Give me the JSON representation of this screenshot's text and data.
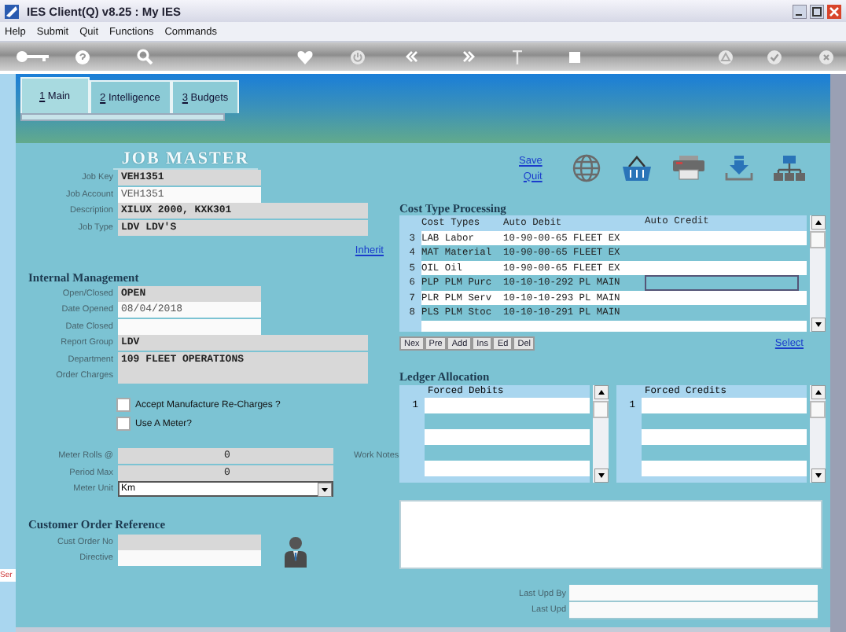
{
  "window": {
    "title": "IES Client(Q) v8.25 : My IES"
  },
  "menu": [
    "Help",
    "Submit",
    "Quit",
    "Functions",
    "Commands"
  ],
  "tabs": [
    {
      "hotkey": "1",
      "label": "Main",
      "selected": true
    },
    {
      "hotkey": "2",
      "label": "Intelligence",
      "selected": false
    },
    {
      "hotkey": "3",
      "label": "Budgets",
      "selected": false
    }
  ],
  "page_title": "JOB MASTER",
  "links": [
    "Save",
    "Quit"
  ],
  "job_fields": [
    {
      "label": "Job Key",
      "value": "VEH1351",
      "kind": "short",
      "editable": false
    },
    {
      "label": "Job Account",
      "value": "VEH1351",
      "kind": "short",
      "editable": true
    },
    {
      "label": "Description",
      "value": "XILUX 2000, KXK301",
      "kind": "wide",
      "editable": false
    },
    {
      "label": "Job Type",
      "value": "LDV LDV'S",
      "kind": "wide",
      "editable": false
    }
  ],
  "inherit_link": "Inherit",
  "internal_management": {
    "heading": "Internal Management",
    "fields": [
      {
        "label": "Open/Closed",
        "value": "OPEN",
        "kind": "short",
        "editable": false
      },
      {
        "label": "Date Opened",
        "value": "08/04/2018",
        "kind": "short",
        "editable": true
      },
      {
        "label": "Date Closed",
        "kind": "short",
        "editable": true
      },
      {
        "label": "Report Group",
        "value": "LDV",
        "kind": "wide",
        "editable": false
      },
      {
        "label": "Department",
        "value": "109 FLEET OPERATIONS",
        "kind": "wide",
        "editable": false
      },
      {
        "label": "Order Charges",
        "kind": "wide",
        "editable": false
      }
    ],
    "checkboxes": [
      {
        "label": "Accept Manufacture Re-Charges ?",
        "checked": false
      },
      {
        "label": "Use A Meter?",
        "checked": false
      }
    ]
  },
  "meter_fields": [
    {
      "label": "Meter Rolls @",
      "value": "0"
    },
    {
      "label": "Period Max",
      "value": "0"
    }
  ],
  "meter_unit": {
    "label": "Meter Unit",
    "value": "Km"
  },
  "customer_order": {
    "heading": "Customer Order Reference",
    "fields": [
      {
        "label": "Cust Order No",
        "editable": false
      },
      {
        "label": "Directive",
        "editable": true
      }
    ]
  },
  "side_tab": "Ser",
  "cost_types": {
    "heading": "Cost Type Processing",
    "columns": [
      "Cost Types",
      "Auto Debit",
      "Auto Credit"
    ],
    "rows": [
      {
        "number": "3",
        "cost_type": "LAB Labor",
        "auto_debit": "10-90-00-65 FLEET EX",
        "focused": false
      },
      {
        "number": "4",
        "cost_type": "MAT Material",
        "auto_debit": "10-90-00-65 FLEET EX",
        "focused": false
      },
      {
        "number": "5",
        "cost_type": "OIL Oil",
        "auto_debit": "10-90-00-65 FLEET EX",
        "focused": false
      },
      {
        "number": "6",
        "cost_type": "PLP PLM Purc",
        "auto_debit": "10-10-10-292 PL MAIN",
        "focused": true
      },
      {
        "number": "7",
        "cost_type": "PLR PLM Serv",
        "auto_debit": "10-10-10-293 PL MAIN",
        "focused": false
      },
      {
        "number": "8",
        "cost_type": "PLS PLM Stoc",
        "auto_debit": "10-10-10-291 PL MAIN",
        "focused": false
      }
    ],
    "buttons": [
      "Nex",
      "Pre",
      "Add",
      "Ins",
      "Ed",
      "Del"
    ],
    "select_link": "Select"
  },
  "ledger": {
    "heading": "Ledger Allocation",
    "lists": [
      {
        "title": "Forced Debits",
        "row_number": "1"
      },
      {
        "title": "Forced Credits",
        "row_number": "1"
      }
    ]
  },
  "work_notes": {
    "label": "Work Notes"
  },
  "audit": [
    {
      "label": "Last Upd By"
    },
    {
      "label": "Last Upd"
    }
  ]
}
